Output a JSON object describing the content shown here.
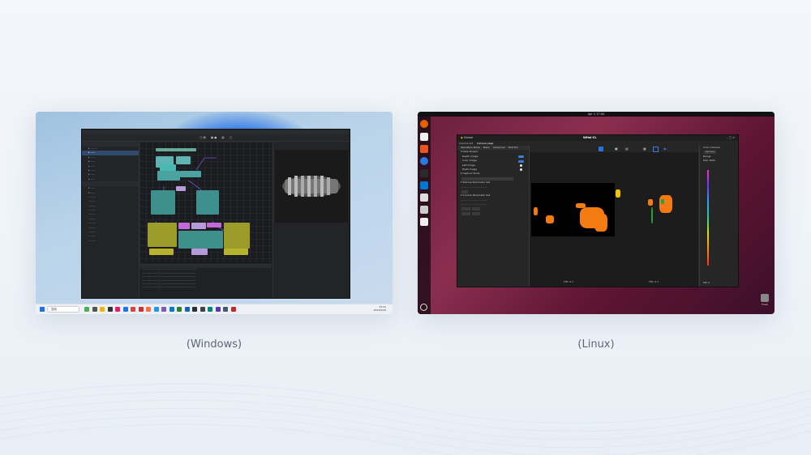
{
  "captions": {
    "windows": "(Windows)",
    "linux": "(Linux)"
  },
  "windows_screenshot": {
    "taskbar_search": "搜索",
    "clock_time": "15:22",
    "clock_date": "2024/6/26"
  },
  "linux_screenshot": {
    "topbar_clock": "Apr 1  17:50",
    "app_title": "Viewer",
    "device_title": "WHal-CL",
    "tabs": [
      "Camera list",
      "Camera page"
    ],
    "mode_tabs": [
      "Operation Mode",
      "Basic",
      "Advanced",
      "Post Pro"
    ],
    "sections": {
      "data_stream": "Data Stream",
      "capture_mode": "Capture Mode",
      "startup_param": "Startup Parameter Set",
      "current_param": "Current Parameter Set"
    },
    "stream_items": [
      "Depth Image",
      "Color Image",
      "Left Image",
      "Right Image"
    ],
    "fps_label": "FPS:",
    "fps_value": "6.7",
    "color_scheme_label": "Color Scheme",
    "color_scheme_value": "Rainbow",
    "range_label": "Range",
    "max_label": "Max 3000",
    "min_label": "Min 0",
    "trash_label": "Trash"
  },
  "colors": {
    "background": "#eef3f8",
    "caption": "#5b6777",
    "accent_orange": "#f47a12",
    "toggle_blue": "#3d7de0"
  }
}
